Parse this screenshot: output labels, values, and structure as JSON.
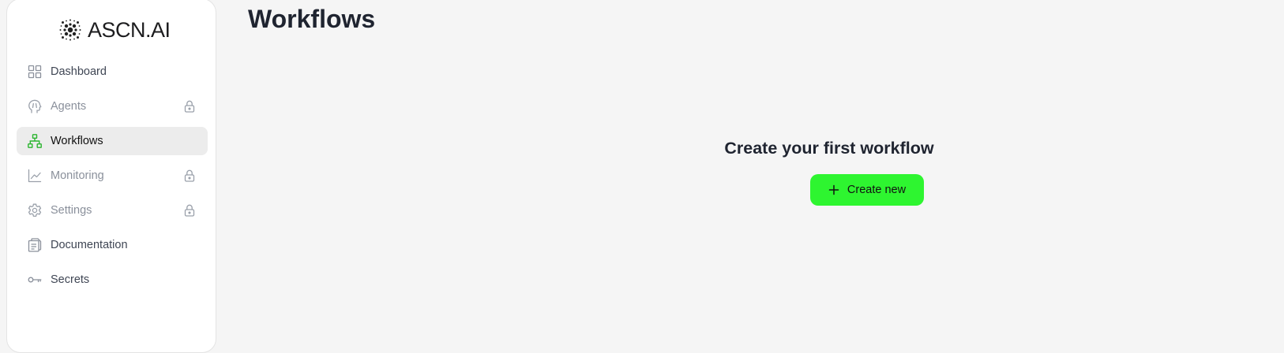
{
  "brand": {
    "name": "ASCN.AI"
  },
  "page": {
    "title": "Workflows"
  },
  "sidebar": {
    "items": [
      {
        "label": "Dashboard",
        "icon": "grid-icon",
        "locked": false,
        "active": false
      },
      {
        "label": "Agents",
        "icon": "brain-icon",
        "locked": true,
        "active": false
      },
      {
        "label": "Workflows",
        "icon": "hierarchy-icon",
        "locked": false,
        "active": true
      },
      {
        "label": "Monitoring",
        "icon": "line-chart-icon",
        "locked": true,
        "active": false
      },
      {
        "label": "Settings",
        "icon": "gear-icon",
        "locked": true,
        "active": false
      },
      {
        "label": "Documentation",
        "icon": "document-icon",
        "locked": false,
        "active": false
      },
      {
        "label": "Secrets",
        "icon": "key-icon",
        "locked": false,
        "active": false
      }
    ]
  },
  "empty_state": {
    "title": "Create your first workflow",
    "button_label": "Create new"
  },
  "colors": {
    "accent": "#2ef530",
    "active_icon": "#2bb52f",
    "background": "#f5f5f5",
    "sidebar": "#ffffff"
  }
}
